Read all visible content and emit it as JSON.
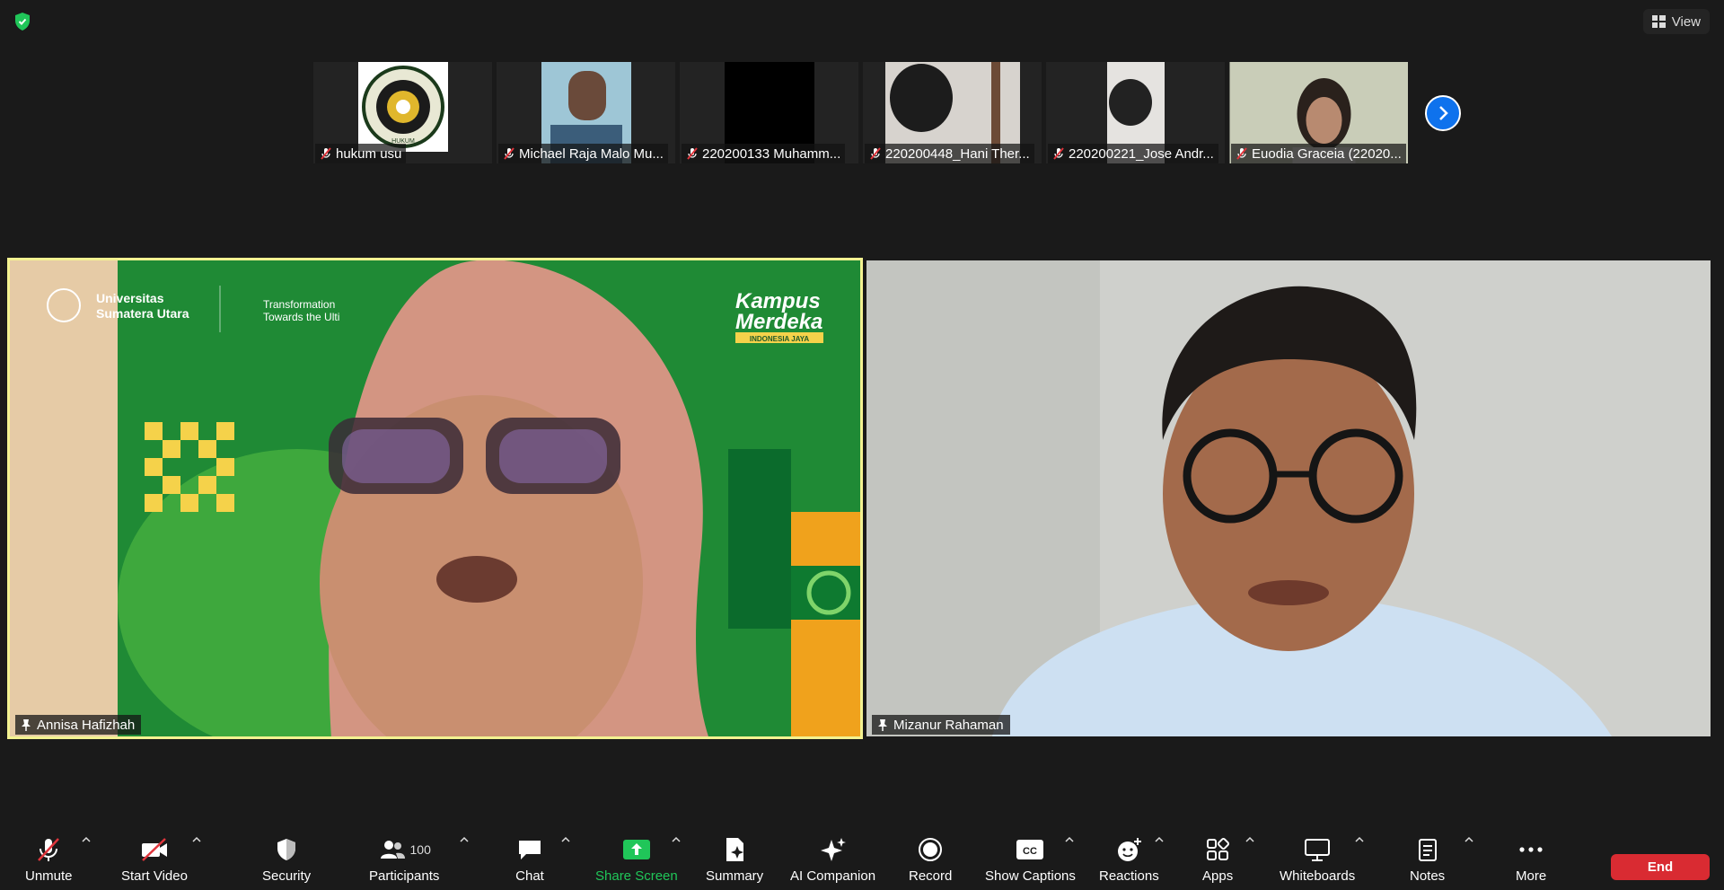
{
  "window": {
    "view_label": "View"
  },
  "filmstrip": [
    {
      "name": "hukum usu",
      "logo_text": "HUKUM"
    },
    {
      "name": "Michael Raja Malo Mu..."
    },
    {
      "name": "220200133 Muhamm..."
    },
    {
      "name": "220200448_Hani Ther..."
    },
    {
      "name": "220200221_Jose Andr..."
    },
    {
      "name": "Euodia Graceia (22020..."
    }
  ],
  "tiles": {
    "left": {
      "name": "Annisa Hafizhah",
      "bg_texts": [
        "Universitas",
        "Sumatera Utara",
        "Transformation",
        "Towards the Ulti",
        "Kampus",
        "Merdeka",
        "INDONESIA JAYA"
      ]
    },
    "right": {
      "name": "Mizanur Rahaman"
    }
  },
  "toolbar": {
    "unmute": "Unmute",
    "start_video": "Start Video",
    "security": "Security",
    "participants": "Participants",
    "participants_count": "100",
    "chat": "Chat",
    "share_screen": "Share Screen",
    "summary": "Summary",
    "ai_companion": "AI Companion",
    "record": "Record",
    "show_captions": "Show Captions",
    "captions_icon_text": "CC",
    "reactions": "Reactions",
    "apps": "Apps",
    "whiteboards": "Whiteboards",
    "notes": "Notes",
    "more": "More",
    "end": "End"
  },
  "colors": {
    "accent": "#0e72ed",
    "share": "#20c659",
    "end": "#d92b32",
    "active_speaker": "#f3f291"
  }
}
